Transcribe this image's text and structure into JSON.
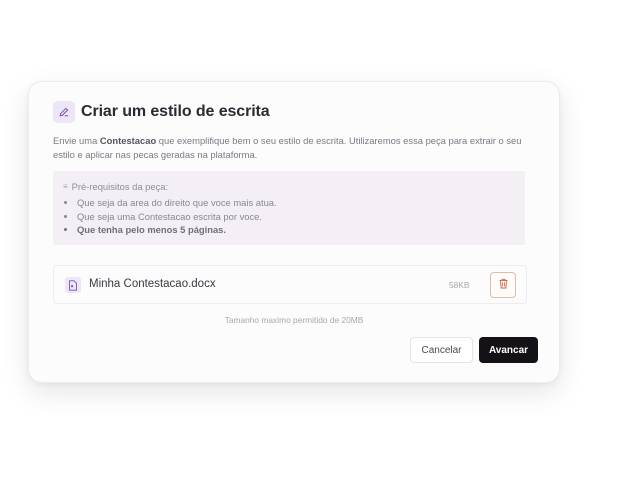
{
  "dialog": {
    "title": "Criar um estilo de escrita",
    "description_prefix": "Envie uma ",
    "description_bold": "Contestacao",
    "description_suffix": " que exemplifique bem o seu estilo de escrita. Utilizaremos essa peça para extrair o seu estilo e aplicar nas pecas geradas na plataforma.",
    "title_icon": "pencil-icon"
  },
  "requirements": {
    "title": "Pré-requisitos da peça:",
    "items": [
      "Que seja da area do direito que voce mais atua.",
      "Que seja uma Contestacao escrita por voce.",
      "Que tenha pelo menos 5 páginas."
    ]
  },
  "file": {
    "name": "Minha Contestacao.docx",
    "size": "58KB",
    "icon": "document-icon",
    "delete_icon": "trash-icon"
  },
  "hint": "Tamanho maximo permitido de 20MB",
  "buttons": {
    "cancel": "Cancelar",
    "next": "Avancar"
  },
  "colors": {
    "accent_light": "#ede6f7",
    "accent": "#8a5cc7",
    "danger": "#c8603e",
    "primary_button": "#141216"
  }
}
